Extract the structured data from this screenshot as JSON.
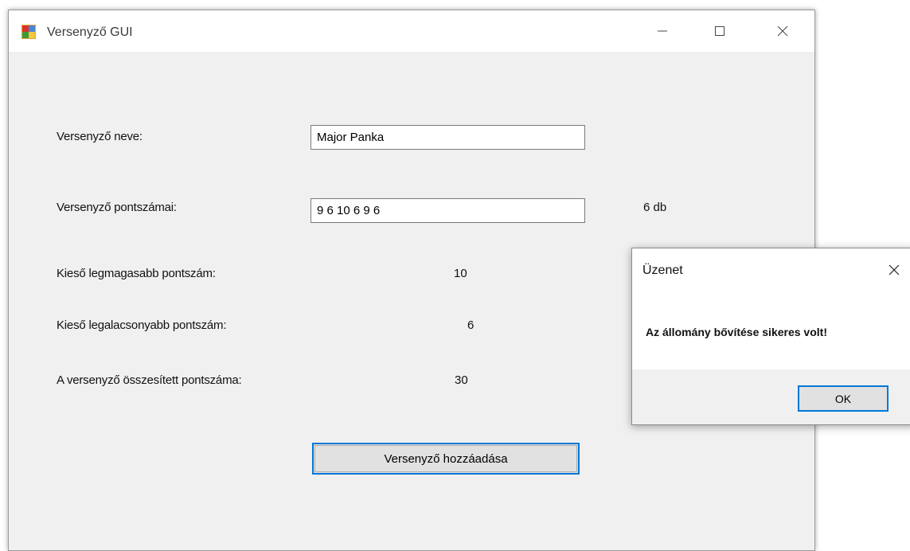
{
  "window": {
    "title": "Versenyző GUI",
    "icon": "winforms-app-icon"
  },
  "form": {
    "name_label": "Versenyző neve:",
    "name_value": "Major Panka",
    "scores_label": "Versenyző pontszámai:",
    "scores_value": "9 6 10 6 9 6",
    "scores_count": "6 db",
    "max_label": "Kieső legmagasabb pontszám:",
    "max_value": "10",
    "min_label": "Kieső legalacsonyabb pontszám:",
    "min_value": "6",
    "total_label": "A versenyző összesített pontszáma:",
    "total_value": "30",
    "add_button": "Versenyző hozzáadása"
  },
  "dialog": {
    "title": "Üzenet",
    "message": "Az állomány bővítése sikeres volt!",
    "ok_button": "OK"
  },
  "colors": {
    "accent": "#0078d7",
    "form_bg": "#f0f0f0",
    "button_bg": "#e1e1e1"
  }
}
